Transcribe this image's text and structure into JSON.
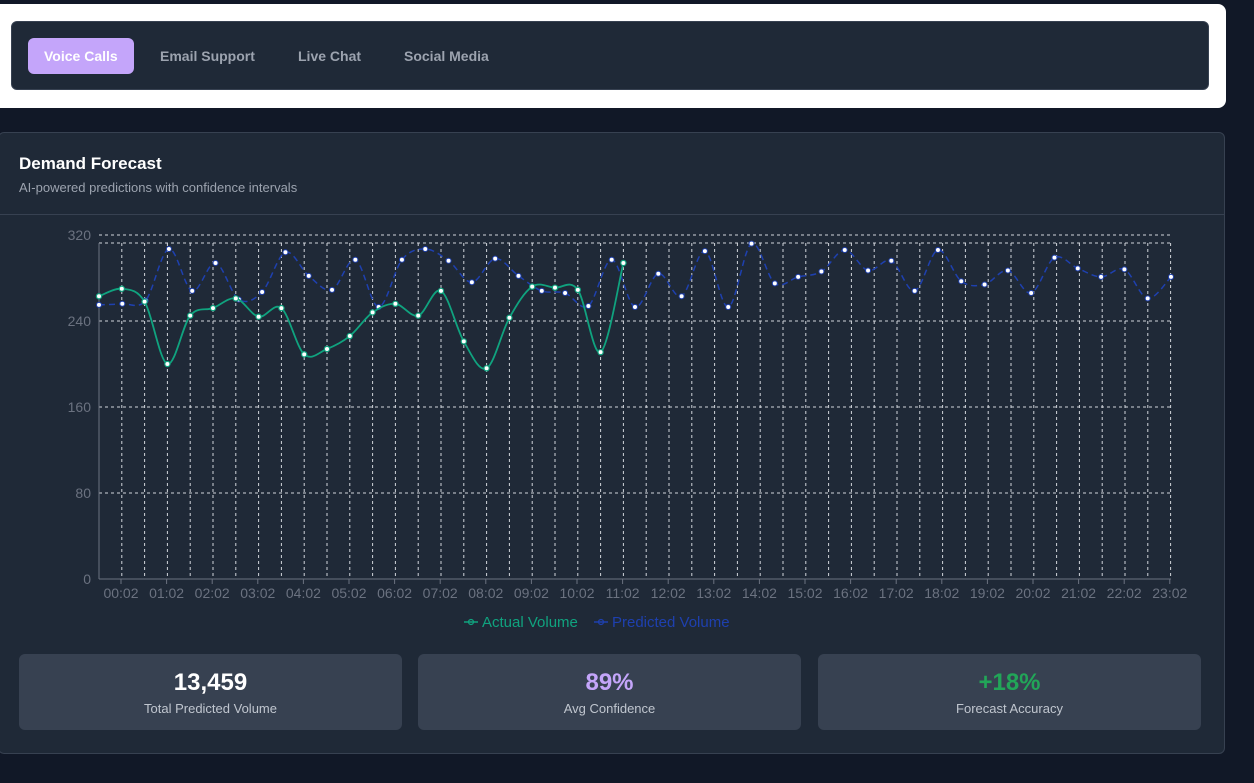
{
  "tabs": [
    {
      "label": "Voice Calls",
      "active": true
    },
    {
      "label": "Email Support",
      "active": false
    },
    {
      "label": "Live Chat",
      "active": false
    },
    {
      "label": "Social Media",
      "active": false
    }
  ],
  "panel": {
    "title": "Demand Forecast",
    "subtitle": "AI-powered predictions with confidence intervals"
  },
  "chart_data": {
    "type": "line",
    "x_labels": [
      "00:02",
      "01:02",
      "02:02",
      "03:02",
      "04:02",
      "05:02",
      "06:02",
      "07:02",
      "08:02",
      "09:02",
      "10:02",
      "11:02",
      "12:02",
      "13:02",
      "14:02",
      "15:02",
      "16:02",
      "17:02",
      "18:02",
      "19:02",
      "20:02",
      "21:02",
      "22:02",
      "23:02"
    ],
    "y_ticks": [
      0,
      80,
      160,
      240,
      320
    ],
    "ylim": [
      0,
      320
    ],
    "grid": true,
    "legend_position": "bottom",
    "series": [
      {
        "name": "Actual Volume",
        "color": "#10a37f",
        "values": [
          263,
          270,
          258,
          200,
          245,
          252,
          261,
          244,
          252,
          209,
          214,
          226,
          248,
          256,
          245,
          268,
          221,
          196,
          243,
          272,
          271,
          269,
          211,
          294
        ]
      },
      {
        "name": "Predicted Volume",
        "color": "#1e40af",
        "values": [
          255,
          256,
          259,
          307,
          268,
          294,
          260,
          267,
          304,
          282,
          269,
          297,
          253,
          297,
          307,
          296,
          276,
          298,
          282,
          268,
          266,
          254,
          297,
          253,
          284,
          263,
          305,
          253,
          312,
          275,
          281,
          286,
          306,
          287,
          296,
          268,
          306,
          277,
          274,
          287,
          266,
          299,
          289,
          281,
          288,
          261,
          281
        ]
      }
    ]
  },
  "stats": [
    {
      "value": "13,459",
      "label": "Total Predicted Volume",
      "color": "#ffffff"
    },
    {
      "value": "89%",
      "label": "Avg Confidence",
      "color": "#c4a5fa"
    },
    {
      "value": "+18%",
      "label": "Forecast Accuracy",
      "color": "#22a558"
    }
  ]
}
